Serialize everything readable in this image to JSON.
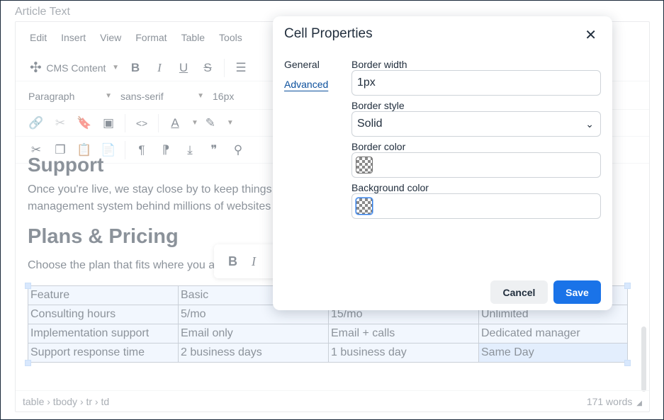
{
  "field_label": "Article Text",
  "menubar": [
    "Edit",
    "Insert",
    "View",
    "Format",
    "Table",
    "Tools"
  ],
  "toolbar": {
    "cms_content_label": "CMS Content",
    "paragraph_label": "Paragraph",
    "font_family_label": "sans-serif",
    "font_size_label": "16px"
  },
  "content": {
    "support_heading": "Support",
    "support_line1": "Once you're live, we stay close by to keep things",
    "support_line2": "management system behind millions of websites",
    "plans_heading": "Plans & Pricing",
    "plans_text": "Choose the plan that fits where you a"
  },
  "table": {
    "rows": [
      [
        "Feature",
        "Basic",
        "",
        ""
      ],
      [
        "Consulting hours",
        "5/mo",
        "15/mo",
        "Unlimited"
      ],
      [
        "Implementation support",
        "Email only",
        "Email + calls",
        "Dedicated manager"
      ],
      [
        "Support response time",
        "2 business days",
        "1 business day",
        "Same Day"
      ]
    ]
  },
  "statusbar": {
    "path": "table › tbody › tr › td",
    "word_count": "171 words"
  },
  "dialog": {
    "title": "Cell Properties",
    "tabs": [
      "General",
      "Advanced"
    ],
    "border_width_label": "Border width",
    "border_width_value": "1px",
    "border_style_label": "Border style",
    "border_style_value": "Solid",
    "border_color_label": "Border color",
    "background_color_label": "Background color",
    "cancel_label": "Cancel",
    "save_label": "Save"
  },
  "colors": {
    "accent": "#1a73e8",
    "table_selection": "#e7f0fd",
    "text": "#222f3e"
  }
}
